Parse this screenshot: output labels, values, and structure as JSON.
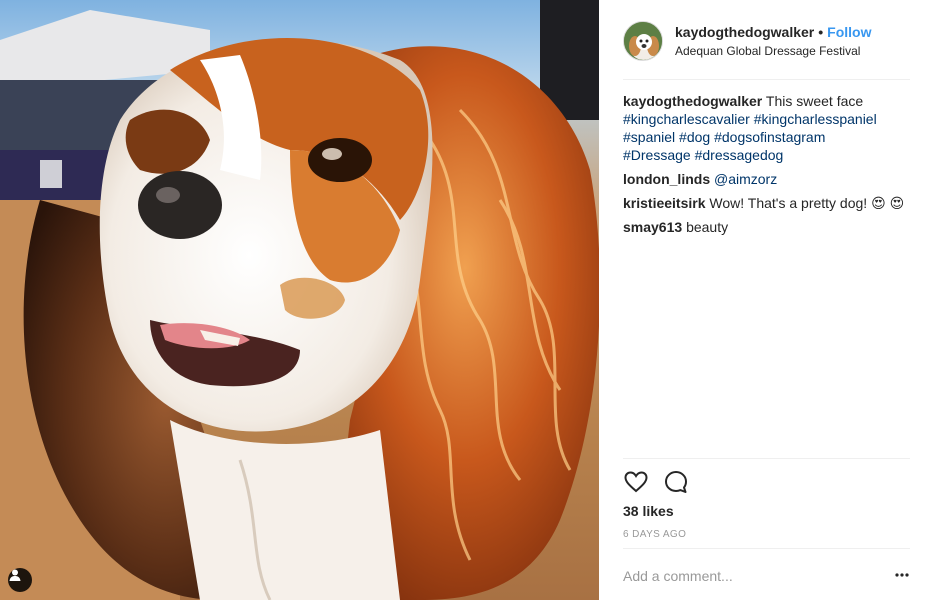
{
  "photo": {
    "subject": "cavalier-king-charles-spaniel",
    "tag_icon": "user-tag-icon"
  },
  "header": {
    "username": "kaydogthedogwalker",
    "separator": "•",
    "follow_label": "Follow",
    "location": "Adequan Global Dressage Festival"
  },
  "caption": {
    "user": "kaydogthedogwalker",
    "text": "This sweet face",
    "hashtags": [
      "#kingcharlescavalier",
      "#kingcharlesspaniel",
      "#spaniel",
      "#dog",
      "#dogsofinstagram",
      "#Dressage",
      "#dressagedog"
    ]
  },
  "comments": [
    {
      "user": "london_linds",
      "mention": "@aimzorz",
      "text": ""
    },
    {
      "user": "kristieeitsirk",
      "text": "Wow! That's a pretty dog! 😍",
      "emoji_extra": "😍"
    },
    {
      "user": "smay613",
      "text": "beauty"
    }
  ],
  "actions": {
    "like_icon": "heart-icon",
    "comment_icon": "comment-icon",
    "likes_text": "38 likes",
    "timestamp": "6 DAYS AGO"
  },
  "add_comment": {
    "placeholder": "Add a comment...",
    "more_icon": "more-options-icon"
  },
  "colors": {
    "link_blue": "#3897f0",
    "hashtag": "#003569",
    "muted": "#999999",
    "text": "#262626"
  }
}
